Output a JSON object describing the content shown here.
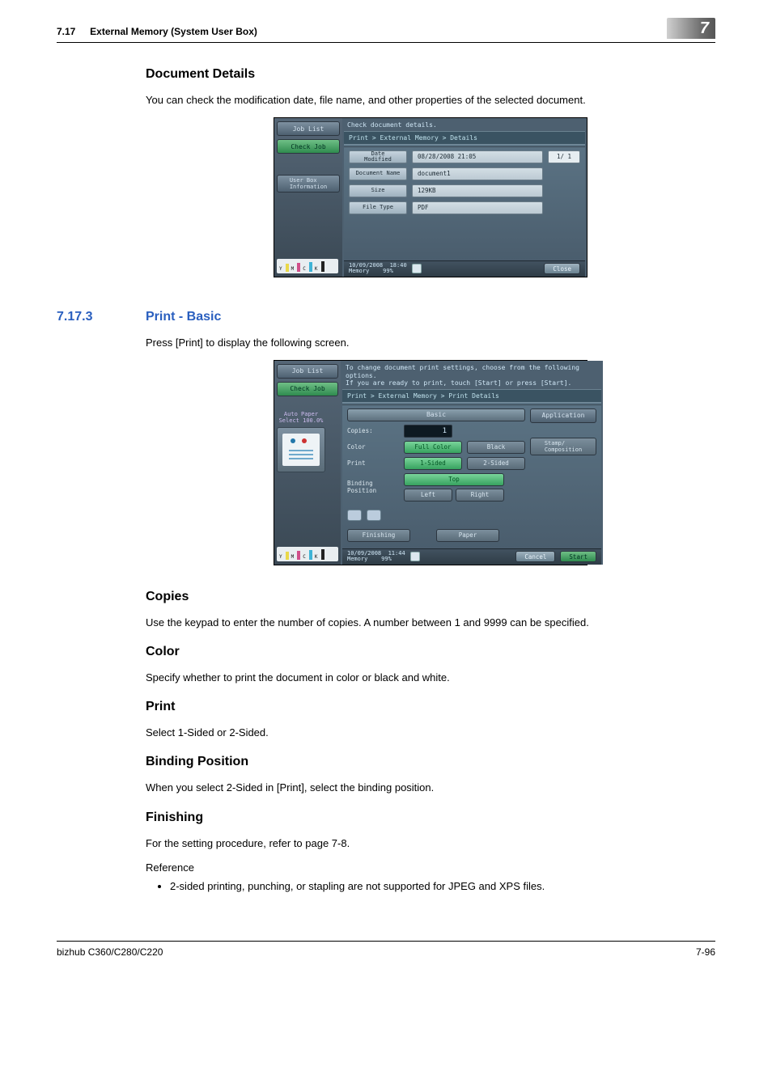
{
  "header": {
    "section_no": "7.17",
    "section_title": "External Memory (System User Box)",
    "chapter_no": "7"
  },
  "doc_details": {
    "heading": "Document Details",
    "body": "You can check the modification date, file name, and other properties of the selected document."
  },
  "shot1": {
    "job_list": "Job List",
    "check_job": "Check Job",
    "user_box": "User Box\nInformation",
    "prompt": "Check document details.",
    "breadcrumb": "Print > External Memory > Details",
    "rows": {
      "date_label": "Date\nModified",
      "date_value": "08/28/2008 21:05",
      "name_label": "Document Name",
      "name_value": "document1",
      "size_label": "Size",
      "size_value": "129KB",
      "type_label": "File Type",
      "type_value": "PDF"
    },
    "pagecounter": "1/ 1",
    "footer": {
      "date": "10/09/2008",
      "time": "18:40",
      "memory_lbl": "Memory",
      "memory_val": "99%",
      "close": "Close"
    },
    "ymck": {
      "Y": "Y",
      "M": "M",
      "C": "C",
      "K": "K"
    }
  },
  "print_basic": {
    "secnum": "7.17.3",
    "sectitle": "Print - Basic",
    "body": "Press [Print] to display the following screen."
  },
  "shot2": {
    "job_list": "Job List",
    "check_job": "Check Job",
    "auto_paper": "Auto Paper\nSelect",
    "zoom": "100.0%",
    "prompt_l1": "To change document print settings, choose from the following options.",
    "prompt_l2": "If you are ready to print, touch [Start] or press [Start].",
    "breadcrumb": "Print > External Memory > Print Details",
    "tabs": {
      "basic": "Basic",
      "app": "Application"
    },
    "rows": {
      "copies_lbl": "Copies:",
      "copies_val": "1",
      "color_lbl": "Color",
      "full_color": "Full Color",
      "black": "Black",
      "print_lbl": "Print",
      "one_sided": "1-Sided",
      "two_sided": "2-Sided",
      "bind_lbl": "Binding\nPosition",
      "top": "Top",
      "left": "Left",
      "right": "Right"
    },
    "bottom": {
      "finishing": "Finishing",
      "paper": "Paper"
    },
    "right": {
      "stamp": "Stamp/\nComposition"
    },
    "footer": {
      "date": "10/09/2008",
      "time": "11:44",
      "memory_lbl": "Memory",
      "memory_val": "99%",
      "cancel": "Cancel",
      "start": "Start"
    },
    "ymck": {
      "Y": "Y",
      "M": "M",
      "C": "C",
      "K": "K"
    }
  },
  "copies": {
    "heading": "Copies",
    "body": "Use the keypad to enter the number of copies. A number between 1 and 9999 can be specified."
  },
  "color": {
    "heading": "Color",
    "body": "Specify whether to print the document in color or black and white."
  },
  "print": {
    "heading": "Print",
    "body": "Select 1-Sided or 2-Sided."
  },
  "binding": {
    "heading": "Binding Position",
    "body": "When you select 2-Sided in [Print], select the binding position."
  },
  "finishing": {
    "heading": "Finishing",
    "body": "For the setting procedure, refer to page 7-8.",
    "reference": "Reference",
    "bullet": "2-sided printing, punching, or stapling are not supported for JPEG and XPS files."
  },
  "footer": {
    "model": "bizhub C360/C280/C220",
    "page": "7-96"
  }
}
